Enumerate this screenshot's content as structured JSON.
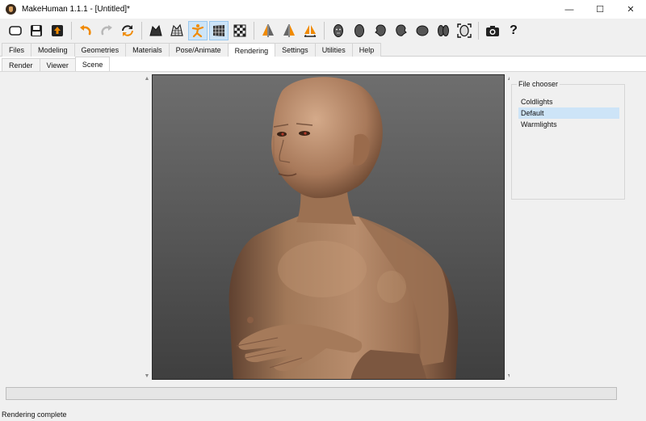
{
  "window": {
    "title": "MakeHuman 1.1.1 - [Untitled]*"
  },
  "window_controls": {
    "minimize": "—",
    "maximize": "☐",
    "close": "✕"
  },
  "toolbar": {
    "help_glyph": "?",
    "buttons": [
      "undo-arrow",
      "redo-arrow",
      "reset-arrows"
    ]
  },
  "tabs": [
    "Files",
    "Modeling",
    "Geometries",
    "Materials",
    "Pose/Animate",
    "Rendering",
    "Settings",
    "Utilities",
    "Help"
  ],
  "active_tab": "Rendering",
  "subtabs": [
    "Render",
    "Viewer",
    "Scene"
  ],
  "active_subtab": "Scene",
  "file_chooser": {
    "title": "File chooser",
    "items": [
      "Coldlights",
      "Default",
      "Warmlights"
    ],
    "selected": "Default"
  },
  "progress": {
    "value": 0
  },
  "status": {
    "text": "Rendering complete"
  },
  "colors": {
    "accent_undo": "#f08a00",
    "selection": "#cde4f7",
    "skin": "#b58a6c"
  }
}
